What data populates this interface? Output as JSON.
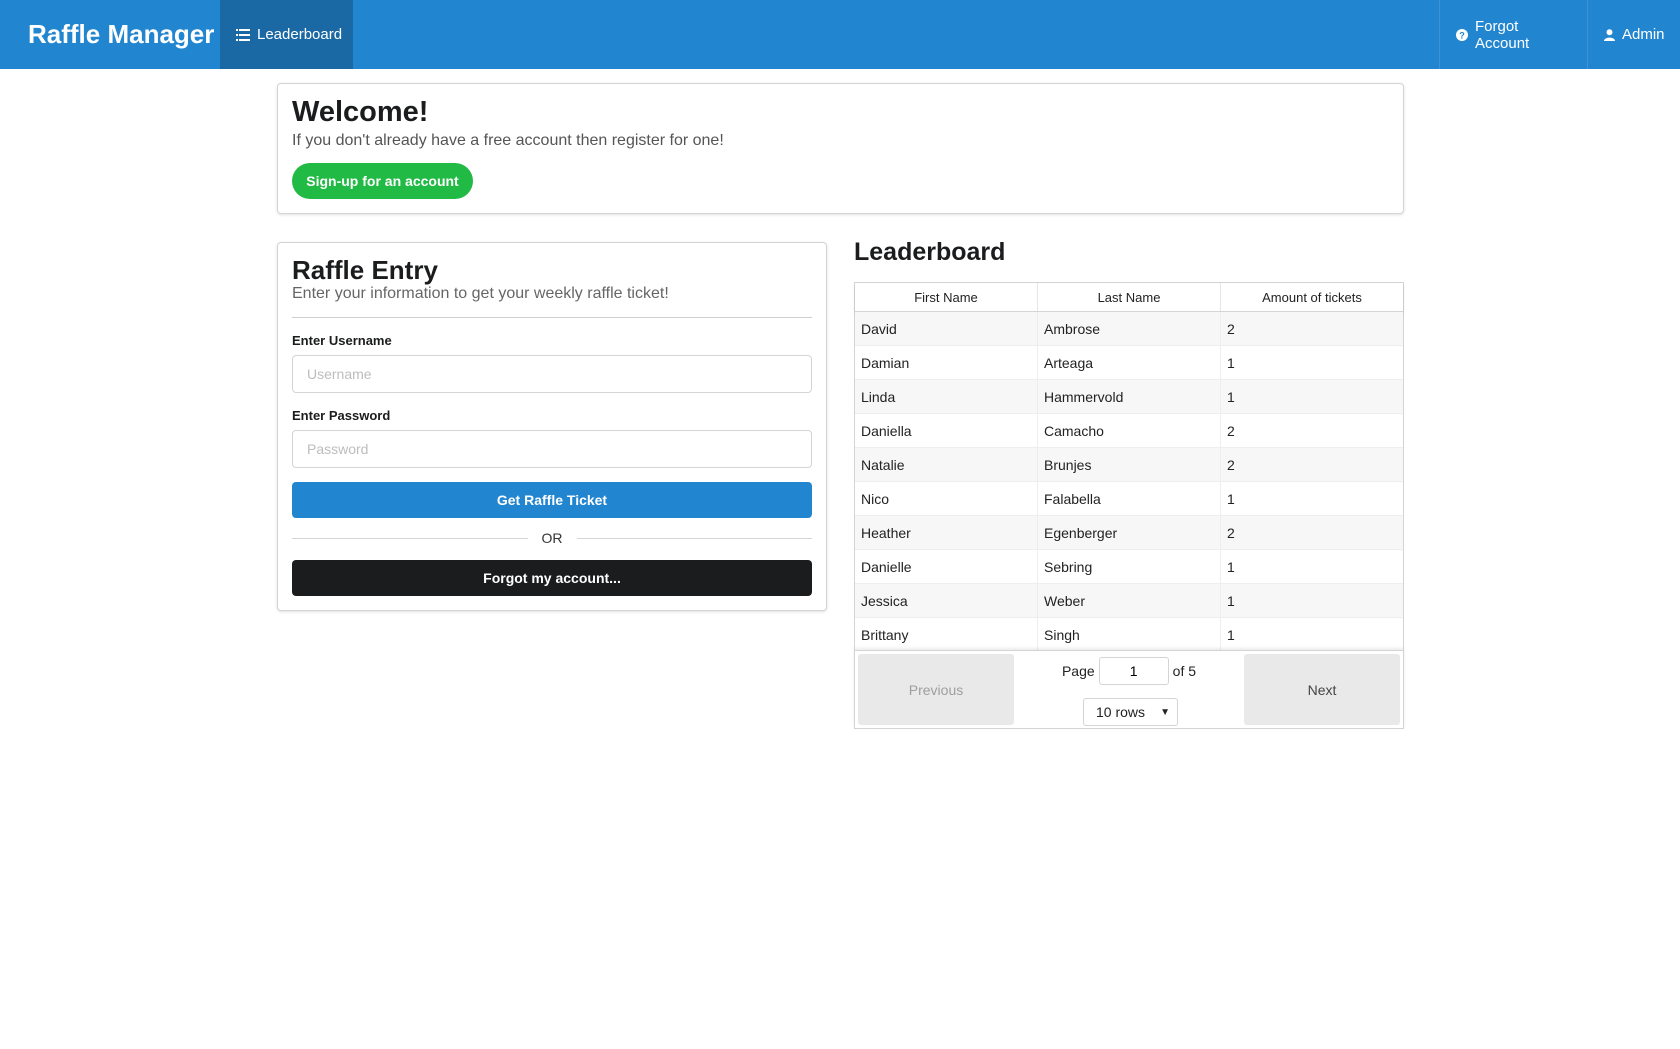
{
  "nav": {
    "brand": "Raffle Manager",
    "leaderboard_label": "Leaderboard",
    "forgot_label": "Forgot Account",
    "admin_label": "Admin",
    "bar_color": "#2185d0",
    "active_color": "#1a69a4"
  },
  "welcome": {
    "title": "Welcome!",
    "text": "If you don't already have a free account then register for one!",
    "signup_label": "Sign-up for an account"
  },
  "raffle": {
    "title": "Raffle Entry",
    "subtitle": "Enter your information to get your weekly raffle ticket!",
    "username_label": "Enter Username",
    "username_placeholder": "Username",
    "username_value": "",
    "password_label": "Enter Password",
    "password_placeholder": "Password",
    "password_value": "",
    "get_ticket_label": "Get Raffle Ticket",
    "or_label": "OR",
    "forgot_label": "Forgot my account..."
  },
  "leaderboard": {
    "title": "Leaderboard",
    "columns": [
      "First Name",
      "Last Name",
      "Amount of tickets"
    ],
    "rows": [
      [
        "David",
        "Ambrose",
        "2"
      ],
      [
        "Damian",
        "Arteaga",
        "1"
      ],
      [
        "Linda",
        "Hammervold",
        "1"
      ],
      [
        "Daniella",
        "Camacho",
        "2"
      ],
      [
        "Natalie",
        "Brunjes",
        "2"
      ],
      [
        "Nico",
        "Falabella",
        "1"
      ],
      [
        "Heather",
        "Egenberger",
        "2"
      ],
      [
        "Danielle",
        "Sebring",
        "1"
      ],
      [
        "Jessica",
        "Weber",
        "1"
      ],
      [
        "Brittany",
        "Singh",
        "1"
      ]
    ],
    "pager": {
      "previous_label": "Previous",
      "next_label": "Next",
      "page_label": "Page",
      "page_value": "1",
      "of_label": "of 5",
      "rows_selected": "10 rows"
    }
  }
}
